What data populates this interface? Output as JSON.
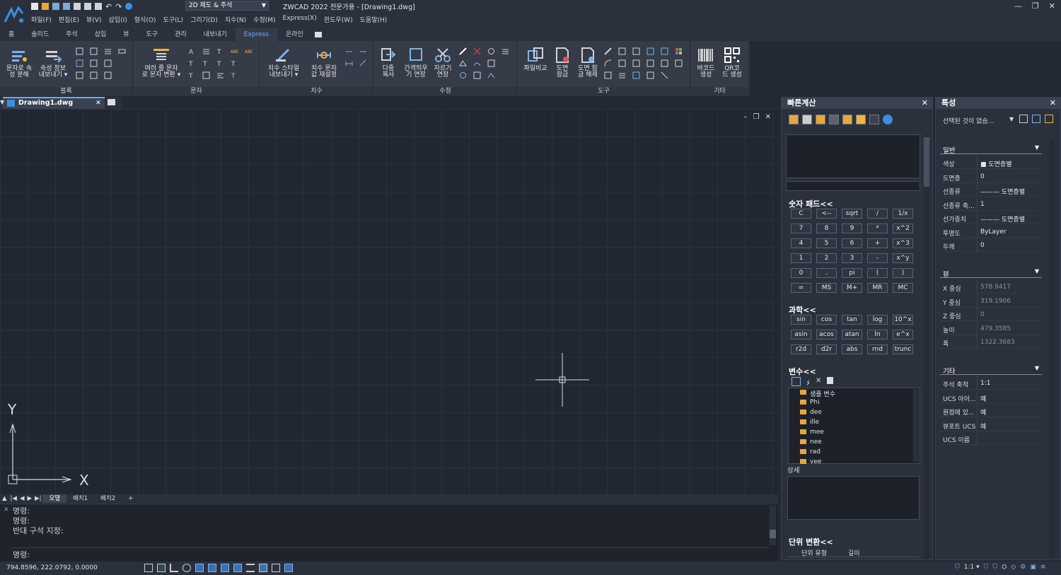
{
  "titlebar": {
    "workspace": "2D 제도 & 주석",
    "app_title": "ZWCAD 2022 전문가용 - [Drawing1.dwg]"
  },
  "menu": [
    "파일(F)",
    "편집(E)",
    "뷰(V)",
    "삽입(I)",
    "형식(O)",
    "도구(L)",
    "그리기(D)",
    "치수(N)",
    "수정(M)",
    "Express(X)",
    "윈도우(W)",
    "도움말(H)"
  ],
  "ribbon_tabs": [
    "홈",
    "솔리드",
    "주석",
    "삽입",
    "뷰",
    "도구",
    "관리",
    "내보내기",
    "Express",
    "온라인"
  ],
  "panels": {
    "block": {
      "title": "블록",
      "b1": "문자로 속",
      "b1b": "성 분해",
      "b2": "속성 정보",
      "b2b": "내보내기 ▾"
    },
    "text": {
      "title": "문자",
      "b1": "여러 줄 문자",
      "b1b": "로 문자 변환 ▾"
    },
    "dim": {
      "title": "치수",
      "b1": "치수 스타일",
      "b1b": "내보내기 ▾",
      "b2": "치수 문자",
      "b2b": "값 재설정"
    },
    "modify": {
      "title": "수정",
      "b1": "다중",
      "b1b": "복사",
      "b2": "간격띄우",
      "b2b": "기 연장",
      "b3": "자르기",
      "b3b": "연장"
    },
    "tools": {
      "title": "도구",
      "b1": "파일비교",
      "b2": "도면",
      "b2b": "잠금",
      "b3": "도면 잠",
      "b3b": "금 해제"
    },
    "other": {
      "title": "기타",
      "b1": "바코드",
      "b1b": "생성",
      "b2": "QR코",
      "b2b": "드 생성"
    }
  },
  "doc_tab": "Drawing1.dwg",
  "layouts": [
    "모델",
    "배치1",
    "배치2",
    "+"
  ],
  "command": {
    "lines": [
      "명령:",
      "명령:",
      "반대 구석 지정:"
    ],
    "prompt": "명령:"
  },
  "status": {
    "coords": "794.8596, 222.0792, 0.0000",
    "scale": "1:1 ▾"
  },
  "quickcalc": {
    "title": "빠른계산",
    "numpad_title": "숫자 패드<<",
    "numpad": [
      [
        "C",
        "<--",
        "sqrt",
        "/",
        "1/x"
      ],
      [
        "7",
        "8",
        "9",
        "*",
        "x^2"
      ],
      [
        "4",
        "5",
        "6",
        "+",
        "x^3"
      ],
      [
        "1",
        "2",
        "3",
        "-",
        "x^y"
      ],
      [
        "0",
        ".",
        "pi",
        "(",
        ")"
      ],
      [
        "=",
        "MS",
        "M+",
        "MR",
        "MC"
      ]
    ],
    "sci_title": "과학<<",
    "sci": [
      [
        "sin",
        "cos",
        "tan",
        "log",
        "10^x"
      ],
      [
        "asin",
        "acos",
        "atan",
        "ln",
        "e^x"
      ],
      [
        "r2d",
        "d2r",
        "abs",
        "rnd",
        "trunc"
      ]
    ],
    "var_title": "변수<<",
    "vars": [
      "샘플 변수",
      "Phi",
      "dee",
      "ille",
      "mee",
      "nee",
      "rad",
      "vee"
    ],
    "detail": "상세",
    "unit_title": "단위 변환<<",
    "unit_type": "단위 유형",
    "unit_val": "길이"
  },
  "props": {
    "title": "특성",
    "sel": "선택된 것이 없슴...",
    "general": "일반",
    "general_rows": [
      [
        "색상",
        "■ 도면층별"
      ],
      [
        "도면층",
        "0"
      ],
      [
        "선종류",
        "——— 도면층별"
      ],
      [
        "선종류 축...",
        "1"
      ],
      [
        "선가중치",
        "——— 도면층별"
      ],
      [
        "투명도",
        "ByLayer"
      ],
      [
        "두께",
        "0"
      ]
    ],
    "view": "뷰",
    "view_rows": [
      [
        "X 중심",
        "578.9417"
      ],
      [
        "Y 중심",
        "319.1906"
      ],
      [
        "Z 중심",
        "0"
      ],
      [
        "높이",
        "479.3585"
      ],
      [
        "폭",
        "1322.3683"
      ]
    ],
    "misc": "기타",
    "misc_rows": [
      [
        "주석 축척",
        "1:1"
      ],
      [
        "UCS 아이...",
        "예"
      ],
      [
        "원점에 있...",
        "예"
      ],
      [
        "뷰포트 UCS",
        "예"
      ],
      [
        "UCS 이름",
        ""
      ]
    ]
  },
  "colors": {
    "accent": "#5fb3ff",
    "bg": "#212732"
  }
}
